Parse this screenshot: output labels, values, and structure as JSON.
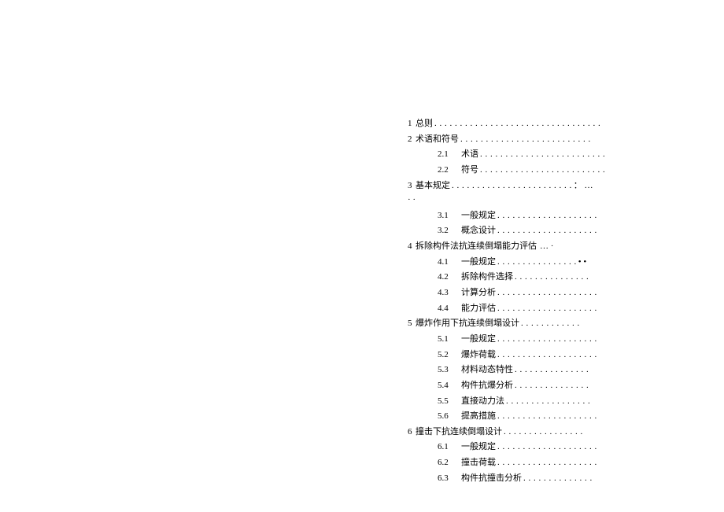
{
  "toc": {
    "ch1": {
      "num": "1",
      "title": "总则",
      "dots": ". . . . . . . . . . . . . . . . . . . . . . . . . . . . . . . . ."
    },
    "ch2": {
      "num": "2",
      "title": "术语和符号",
      "dots": ". . . . . . . . . . . . . . . . . . . . . . . . . ."
    },
    "ch2_1": {
      "num": "2.1",
      "title": "术语",
      "dots": " . . . . . . . . . . . . . . . . . . . . . . . . ."
    },
    "ch2_2": {
      "num": "2.2",
      "title": "符号",
      "dots": " . . . . . . . . . . . . . . . . . . . . . . . . ."
    },
    "ch3": {
      "num": "3",
      "title": "基本规定",
      "dots": ". . . . . . . . . . . . . . . . . . . . . . . .",
      "trail": " ： …",
      "overflow": "· ·"
    },
    "ch3_1": {
      "num": "3.1",
      "title": "一般规定",
      "dots": " . . . . . . . . . . . . . . . . . . . ."
    },
    "ch3_2": {
      "num": "3.2",
      "title": "概念设计",
      "dots": " . . . . . . . . . . . . . . . . . . . ."
    },
    "ch4": {
      "num": "4",
      "title": "拆除构件法抗连续倒塌能力评估",
      "trail": "… ·"
    },
    "ch4_1": {
      "num": "4.1",
      "title": "一般规定",
      "dots": " . . . . . . . . . . . . . . . .",
      "trail": " • •"
    },
    "ch4_2": {
      "num": "4.2",
      "title": "拆除构件选择",
      "dots": " . . . . . . . . . . . . . . ."
    },
    "ch4_3": {
      "num": "4.3",
      "title": "计算分析",
      "dots": " . . . . . . . . . . . . . . . . . . . ."
    },
    "ch4_4": {
      "num": "4.4",
      "title": "能力评估",
      "dots": " . . . . . . . . . . . . . . . . . . . ."
    },
    "ch5": {
      "num": "5",
      "title": "爆炸作用下抗连续倒塌设计",
      "dots": ". . . . . . . . . . . ."
    },
    "ch5_1": {
      "num": "5.1",
      "title": "一般规定",
      "dots": " . . . . . . . . . . . . . . . . . . . ."
    },
    "ch5_2": {
      "num": "5.2",
      "title": "爆炸荷载",
      "dots": " . . . . . . . . . . . . . . . . . . . ."
    },
    "ch5_3": {
      "num": "5.3",
      "title": "材料动态特性",
      "dots": " . . . . . . . . . . . . . . ."
    },
    "ch5_4": {
      "num": "5.4",
      "title": "构件抗爆分析",
      "dots": " . . . . . . . . . . . . . . ."
    },
    "ch5_5": {
      "num": "5.5",
      "title": "直接动力法",
      "dots": " . . . . . . . . . . . . . . . . ."
    },
    "ch5_6": {
      "num": "5.6",
      "title": "提高措施",
      "dots": " . . . . . . . . . . . . . . . . . . . ."
    },
    "ch6": {
      "num": "6",
      "title": "撞击下抗连续倒塌设计",
      "dots": ". . . . . . . . . . . . . . . ."
    },
    "ch6_1": {
      "num": "6.1",
      "title": "一般规定",
      "dots": " . . . . . . . . . . . . . . . . . . . ."
    },
    "ch6_2": {
      "num": "6.2",
      "title": "撞击荷载",
      "dots": " . . . . . . . . . . . . . . . . . . . ."
    },
    "ch6_3": {
      "num": "6.3",
      "title": "构件抗撞击分析",
      "dots": " . . . . . . . . . . . . . ."
    }
  }
}
